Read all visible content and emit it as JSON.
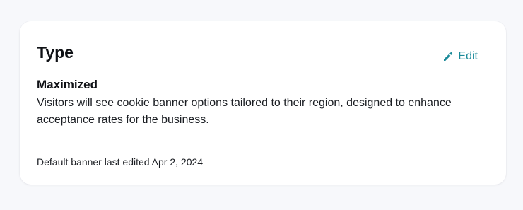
{
  "card": {
    "title": "Type",
    "edit_label": "Edit",
    "edit_icon": "pencil-icon",
    "type_name": "Maximized",
    "description": "Visitors will see cookie banner options tailored to their region, designed to enhance acceptance rates for the business.",
    "last_edited": "Default banner last edited Apr 2, 2024"
  },
  "colors": {
    "accent": "#1a8a99",
    "page_background": "#f7f8fb",
    "card_background": "#ffffff"
  }
}
